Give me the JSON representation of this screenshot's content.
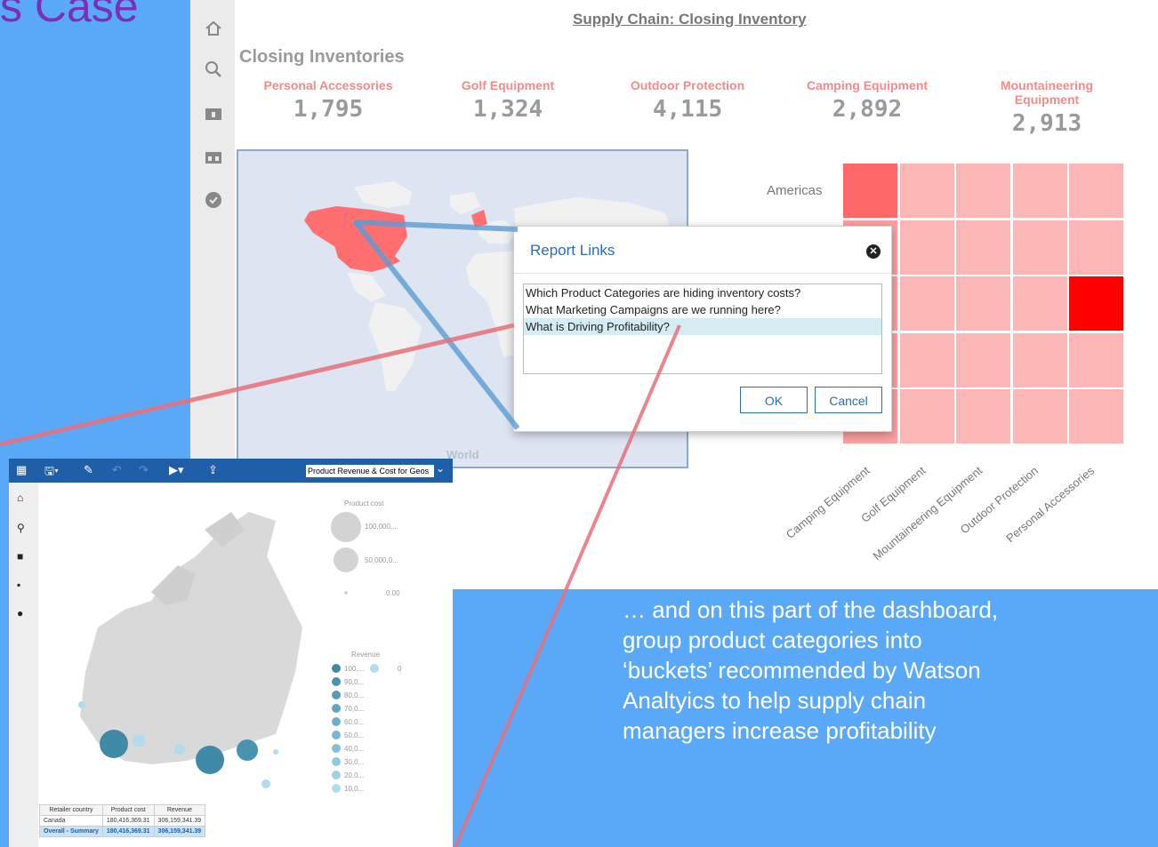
{
  "slide": {
    "title_fragment": "s Case",
    "callout": "… and on this part of the dashboard, group product categories  into ‘buckets’ recommended by Watson Analtyics to help supply chain managers increase profitability"
  },
  "dashboard": {
    "title": "Supply Chain: Closing Inventory",
    "section_heading": "Closing Inventories",
    "kpis": [
      {
        "label": "Personal Accessories",
        "value": "1,795"
      },
      {
        "label": "Golf Equipment",
        "value": "1,324"
      },
      {
        "label": "Outdoor Protection",
        "value": "4,115"
      },
      {
        "label": "Camping Equipment",
        "value": "2,892"
      },
      {
        "label": "Mountaineering Equipment",
        "value": "2,913"
      }
    ],
    "map_caption": "World",
    "nav_icons": [
      "home-icon",
      "search-icon",
      "folder-icon",
      "team-folder-icon",
      "recent-icon"
    ]
  },
  "chart_data": {
    "type": "heatmap",
    "rows": [
      "Americas",
      "",
      "",
      "",
      ""
    ],
    "columns": [
      "Camping Equipment",
      "Golf Equipment",
      "Mountaineering Equipment",
      "Outdoor Protection",
      "Personal Accessories"
    ],
    "values": [
      [
        0.55,
        0.2,
        0.2,
        0.2,
        0.2
      ],
      [
        0.3,
        0.2,
        0.2,
        0.2,
        0.2
      ],
      [
        0.3,
        0.2,
        0.2,
        0.2,
        1.0
      ],
      [
        0.3,
        0.2,
        0.2,
        0.2,
        0.2
      ],
      [
        0.3,
        0.2,
        0.2,
        0.2,
        0.2
      ]
    ],
    "colors": {
      "low": "#fde4e4",
      "high": "#ff0000"
    }
  },
  "dialog": {
    "title": "Report Links",
    "links": [
      "Which Product Categories are hiding inventory costs?",
      "What Marketing Campaigns are we running here?",
      "What is Driving Profitability?"
    ],
    "selected_index": 2,
    "ok_label": "OK",
    "cancel_label": "Cancel"
  },
  "inset": {
    "report_select": "Product Revenue & Cost for Geos",
    "legend_cost": {
      "title": "Product cost",
      "labels": [
        "100,000,...",
        "50,000,0...",
        "0.00"
      ]
    },
    "legend_revenue": {
      "title": "Revenue",
      "labels": [
        "100,...",
        "90,0...",
        "80,0...",
        "70,0...",
        "60,0...",
        "50,0...",
        "40,0...",
        "30,0...",
        "20,0...",
        "10,0..."
      ],
      "zero_label": "0",
      "colors": [
        "#3f8aa6",
        "#4a93ae",
        "#569cb6",
        "#62a5be",
        "#6eaec6",
        "#7ab7ce",
        "#86c0d6",
        "#92c9de",
        "#a0d2e6",
        "#b0dcee"
      ]
    },
    "table": {
      "headers": [
        "Retailer country",
        "Product cost",
        "Revenue"
      ],
      "rows": [
        [
          "Canada",
          "180,416,369.31",
          "306,159,341.39"
        ]
      ],
      "summary": [
        "Overall - Summary",
        "180,416,369.31",
        "306,159,341.39"
      ]
    }
  },
  "colors": {
    "accent": "#1f5fa8",
    "background": "#5aa9f8",
    "link": "#2a6db5"
  }
}
